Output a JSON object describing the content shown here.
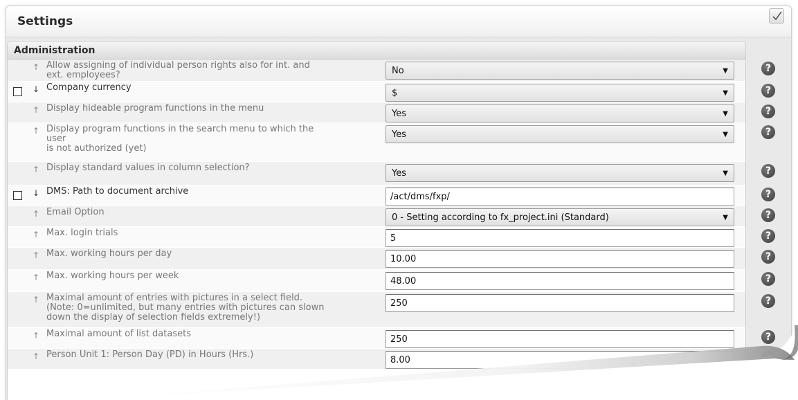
{
  "window": {
    "title": "Settings",
    "confirm_icon": "checkmark-icon"
  },
  "section": {
    "title": "Administration"
  },
  "rows": [
    {
      "arrow": "↑",
      "label": "Allow assigning of individual person rights also for int. and\next. employees?",
      "field_type": "select",
      "value": "No",
      "checkbox": false
    },
    {
      "arrow": "↓",
      "label": "Company currency",
      "field_type": "select",
      "value": "$",
      "checkbox": true
    },
    {
      "arrow": "↑",
      "label": "Display hideable program functions in the menu",
      "field_type": "select",
      "value": "Yes",
      "checkbox": false
    },
    {
      "arrow": "↑",
      "label": "Display program functions in the search menu to which the\nuser\nis not authorized (yet)",
      "field_type": "select",
      "value": "Yes",
      "checkbox": false
    },
    {
      "arrow": "↑",
      "label": "Display standard values in column selection?",
      "field_type": "select",
      "value": "Yes",
      "checkbox": false
    },
    {
      "arrow": "↓",
      "label": "DMS: Path to document archive",
      "field_type": "text",
      "value": "/act/dms/fxp/",
      "checkbox": true
    },
    {
      "arrow": "↑",
      "label": "Email Option",
      "field_type": "select",
      "value": "0 - Setting according to fx_project.ini (Standard)",
      "checkbox": false
    },
    {
      "arrow": "↑",
      "label": "Max. login trials",
      "field_type": "text",
      "value": "5",
      "checkbox": false
    },
    {
      "arrow": "↑",
      "label": "Max. working hours per day",
      "field_type": "text",
      "value": "10.00",
      "checkbox": false
    },
    {
      "arrow": "↑",
      "label": "Max. working hours per week",
      "field_type": "text",
      "value": "48.00",
      "checkbox": false
    },
    {
      "arrow": "↑",
      "label": "Maximal amount of entries with pictures in a select field.\n(Note: 0=unlimited, but many entries with pictures can slown\ndown the display of selection fields extremely!)",
      "field_type": "text",
      "value": "250",
      "checkbox": false
    },
    {
      "arrow": "↑",
      "label": "Maximal amount of list datasets",
      "field_type": "text",
      "value": "250",
      "checkbox": false
    },
    {
      "arrow": "↑",
      "label": "Person Unit 1: Person Day (PD) in Hours (Hrs.)",
      "field_type": "text",
      "value": "8.00",
      "checkbox": false
    }
  ],
  "help_icon": "?",
  "colors": {
    "header_bg": "#f0f0f0",
    "row_odd": "#f0f0f0",
    "row_even": "#fafafa",
    "help_icon": "#4a4a4a"
  }
}
